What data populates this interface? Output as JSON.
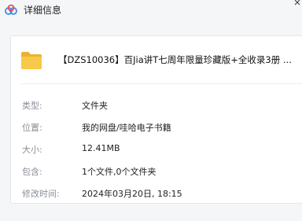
{
  "window": {
    "title": "详细信息"
  },
  "file": {
    "name": "【DZS10036】百Jia讲T七周年限量珍藏版+全收录3册 ..."
  },
  "details": [
    {
      "label": "类型:",
      "value": "文件夹"
    },
    {
      "label": "位置:",
      "value": "我的网盘/哇哈电子书籍"
    },
    {
      "label": "大小:",
      "value": "12.41MB"
    },
    {
      "label": "包含:",
      "value": "1个文件,0个文件夹"
    },
    {
      "label": "修改时间:",
      "value": "2024年03月20日, 18:15"
    }
  ],
  "colors": {
    "folder": "#f7c948",
    "cloud_blue": "#3c8df2",
    "cloud_red": "#ef4d4d"
  },
  "icons": {
    "app": "cloud-logo-icon",
    "folder": "folder-icon",
    "close": "close-icon"
  }
}
